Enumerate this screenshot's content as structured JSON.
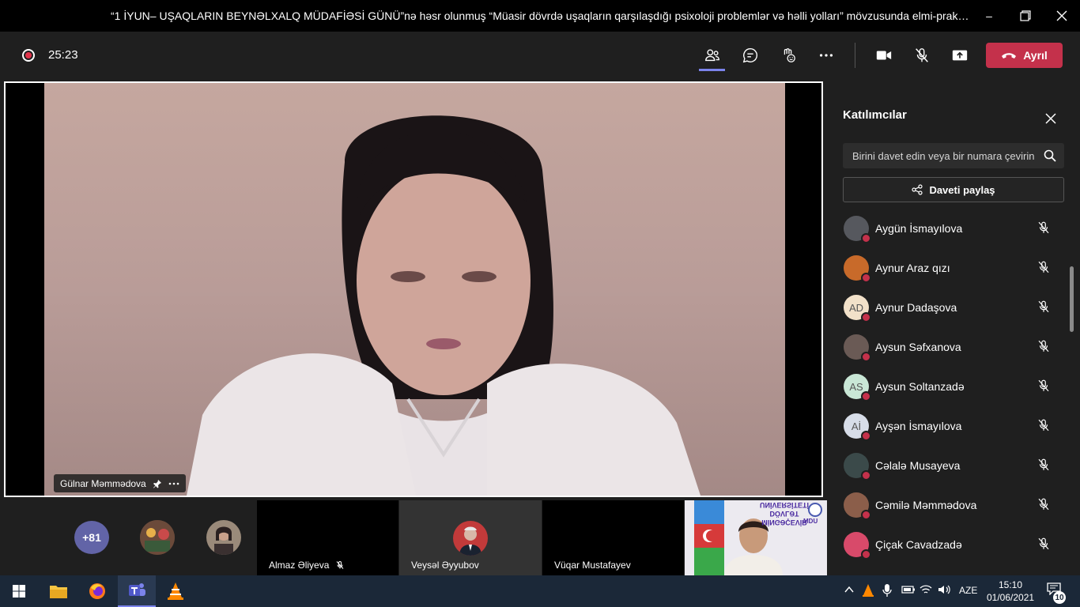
{
  "window": {
    "title": "“1 İYUN– UŞAQLARIN BEYNƏLXALQ MÜDAFİƏSİ GÜNÜ”nə həsr olunmuş “Müasir dövrdə uşaqların qarşılaşdığı psixoloji problemlər və həlli yolları” mövzusunda elmi-praktik ...",
    "controls": [
      "minimize-icon",
      "restore-icon",
      "close-icon"
    ]
  },
  "meeting": {
    "timer": "25:23",
    "leave_label": "Ayrıl",
    "toolbar_icons": [
      "participants-icon",
      "chat-icon",
      "reactions-icon",
      "more-options-icon",
      "camera-icon",
      "mic-off-icon",
      "share-screen-icon"
    ],
    "accent": "#6264a7",
    "leave_color": "#c4314b"
  },
  "stage": {
    "speaker_name": "Gülnar Məmmədova"
  },
  "strip": {
    "more_count": "+81",
    "tiles": [
      {
        "name": "Almaz Əliyeva",
        "muted": true
      },
      {
        "name": "Veysəl Əyyubov",
        "muted": false
      },
      {
        "name": "Vüqar Mustafayev",
        "muted": false
      }
    ],
    "banner_text": [
      "MİNGƏÇEVİR",
      "DÖVLƏT",
      "UNİVERSİTETİ",
      "MDU"
    ]
  },
  "panel": {
    "title": "Katılımcılar",
    "search_placeholder": "Birini davet edin veya bir numara çevirin",
    "share_label": "Daveti paylaş",
    "participants": [
      {
        "name": "Aygün İsmayılova",
        "initials": "",
        "avatar_color": "#56585e"
      },
      {
        "name": "Aynur Araz qızı",
        "initials": "",
        "avatar_color": "#c86a2a"
      },
      {
        "name": "Aynur Dadaşova",
        "initials": "AD",
        "avatar_color": "#f2e1c9"
      },
      {
        "name": "Aysun Səfxanova",
        "initials": "",
        "avatar_color": "#6a5a55"
      },
      {
        "name": "Aysun Soltanzadə",
        "initials": "AS",
        "avatar_color": "#c9e7d6"
      },
      {
        "name": "Ayşən İsmayılova",
        "initials": "Aİ",
        "avatar_color": "#d7dde8"
      },
      {
        "name": "Cəlalə Musayeva",
        "initials": "",
        "avatar_color": "#3b4a4a"
      },
      {
        "name": "Cəmilə Məmmədova",
        "initials": "",
        "avatar_color": "#8b5e4a"
      },
      {
        "name": "Çiçak Cavadzadə",
        "initials": "",
        "avatar_color": "#d84a6a"
      }
    ]
  },
  "taskbar": {
    "apps": [
      "windows-start-icon",
      "file-explorer-icon",
      "firefox-icon",
      "teams-icon",
      "vlc-icon"
    ],
    "language": "AZE",
    "time": "15:10",
    "date": "01/06/2021",
    "notification_count": "10"
  }
}
